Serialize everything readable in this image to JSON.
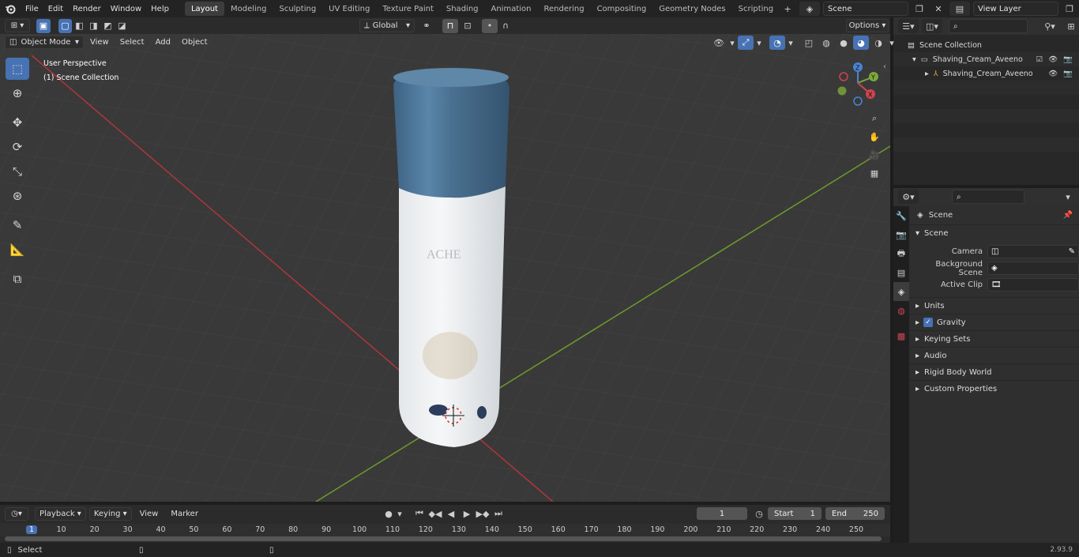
{
  "app": {
    "title": "Blender"
  },
  "menu": [
    "File",
    "Edit",
    "Render",
    "Window",
    "Help"
  ],
  "workspaces": [
    "Layout",
    "Modeling",
    "Sculpting",
    "UV Editing",
    "Texture Paint",
    "Shading",
    "Animation",
    "Rendering",
    "Compositing",
    "Geometry Nodes",
    "Scripting"
  ],
  "scene_field": "Scene",
  "view_layer_field": "View Layer",
  "viewport_header": {
    "mode": "Object Mode",
    "menus": [
      "View",
      "Select",
      "Add",
      "Object"
    ],
    "transform_orientation": "Global",
    "options": "Options"
  },
  "viewport": {
    "info_line1": "User Perspective",
    "info_line2": "(1) Scene Collection",
    "label_partial": "ACHE"
  },
  "gizmo": {
    "x": "X",
    "y": "Y",
    "z": "Z"
  },
  "outliner": {
    "root": "Scene Collection",
    "items": [
      "Shaving_Cream_Aveeno",
      "Shaving_Cream_Aveeno"
    ]
  },
  "properties": {
    "context": "Scene",
    "section": "Scene",
    "camera_label": "Camera",
    "background_scene_label": "Background Scene",
    "active_clip_label": "Active Clip",
    "panels": [
      "Units",
      "Gravity",
      "Keying Sets",
      "Audio",
      "Rigid Body World",
      "Custom Properties"
    ]
  },
  "timeline": {
    "menus": [
      "Playback",
      "Keying",
      "View",
      "Marker"
    ],
    "current_frame": "1",
    "start_label": "Start",
    "start_value": "1",
    "end_label": "End",
    "end_value": "250",
    "ruler": [
      "1",
      "10",
      "20",
      "30",
      "40",
      "50",
      "60",
      "70",
      "80",
      "90",
      "100",
      "110",
      "120",
      "130",
      "140",
      "150",
      "160",
      "170",
      "180",
      "190",
      "200",
      "210",
      "220",
      "230",
      "240",
      "250"
    ]
  },
  "statusbar": {
    "left": "Select",
    "version": "2.93.9"
  },
  "colors": {
    "accent": "#4772b3",
    "cap": "#4a7090",
    "x_axis": "#b0353c",
    "y_axis": "#6e9a2c"
  }
}
